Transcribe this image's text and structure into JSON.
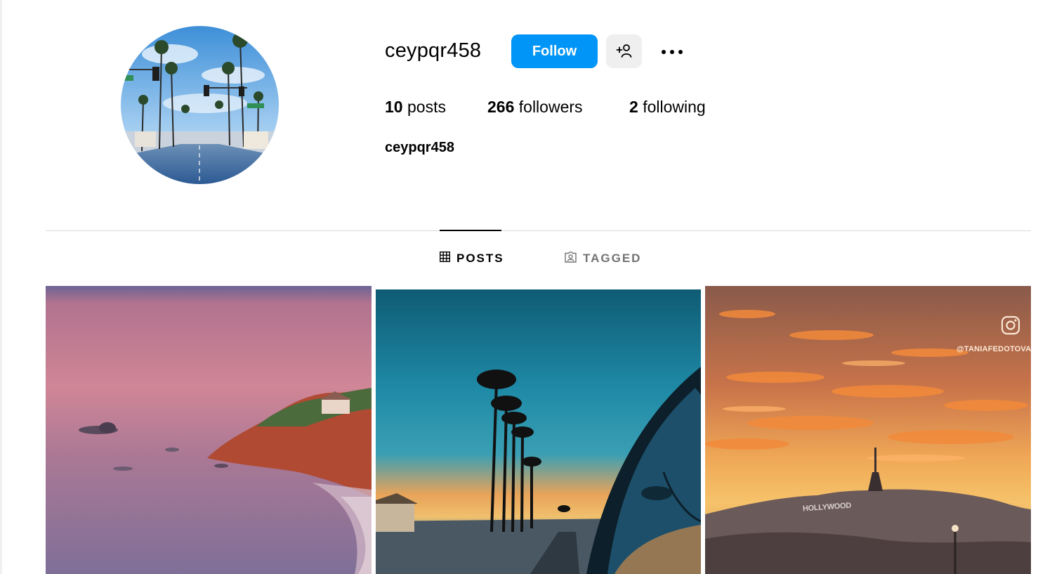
{
  "profile": {
    "username": "ceypqr458",
    "follow_label": "Follow",
    "suggest_icon": "add-person-icon",
    "more_icon": "more-options-icon",
    "posts_count": "10",
    "posts_label": "posts",
    "followers_count": "266",
    "followers_label": "followers",
    "following_count": "2",
    "following_label": "following",
    "display_name": "ceypqr458"
  },
  "tabs": [
    {
      "label": "POSTS",
      "icon": "grid-icon",
      "active": true
    },
    {
      "label": "TAGGED",
      "icon": "tagged-icon",
      "active": false
    }
  ],
  "posts": [
    {
      "thumbnail": "pink-dusk-coastal-cliff"
    },
    {
      "thumbnail": "palm-trees-sunset-car-reflection"
    },
    {
      "thumbnail": "hollywood-sign-orange-sunset",
      "watermark": "@TANIAFEDOTOVA",
      "sign_text": "HOLLYWOOD"
    }
  ],
  "colors": {
    "accent": "#0095f6",
    "button_gray": "#efefef",
    "divider": "#dbdbdb",
    "muted": "#737373"
  }
}
